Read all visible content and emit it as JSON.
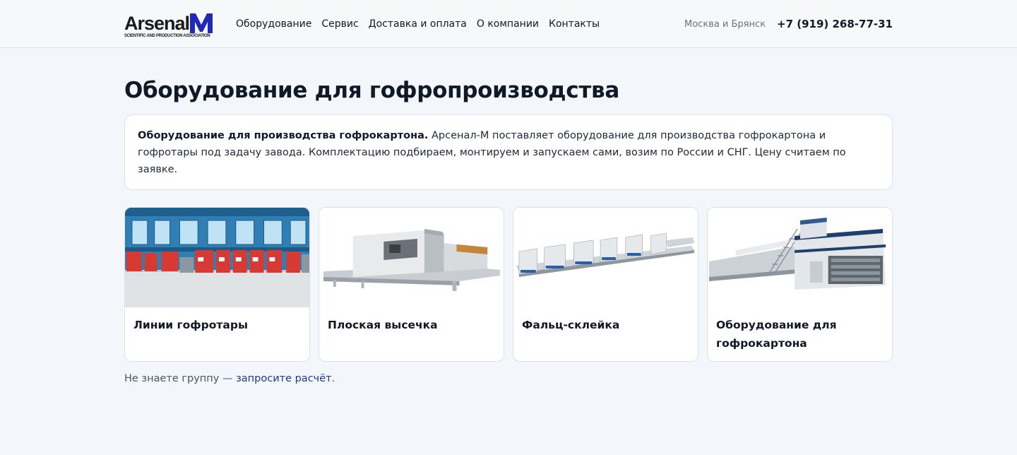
{
  "header": {
    "logo": {
      "word": "Arsenal",
      "letter": "M",
      "tagline": "SCIENTIFIC AND PRODUCTION ASSOCIATION"
    },
    "nav": [
      {
        "label": "Оборудование"
      },
      {
        "label": "Сервис"
      },
      {
        "label": "Доставка и оплата"
      },
      {
        "label": "О компании"
      },
      {
        "label": "Контакты"
      }
    ],
    "city": "Москва и Брянск",
    "phone": "+7 (919) 268-77-31"
  },
  "main": {
    "title": "Оборудование для гофропроизводства",
    "intro": {
      "lead": "Оборудование для производства гофрокартона.",
      "text": " Арсенал-М поставляет оборудование для производства гофрокартона и гофротары под задачу завода. Комплектацию подбираем, монтируем и запускаем сами, возим по России и СНГ. Цену считаем по заявке."
    },
    "cards": [
      {
        "title": "Линии гофротары"
      },
      {
        "title": "Плоская высечка"
      },
      {
        "title": "Фальц-склейка"
      },
      {
        "title": "Оборудование для гофрокартона"
      }
    ],
    "footnote": {
      "prefix": "Не знаете группу — ",
      "link": "запросите расчёт",
      "suffix": "."
    }
  },
  "colors": {
    "background": "#f3f6fb",
    "logo_accent": "#1f2bb8",
    "link": "#1e3a8a",
    "line_red": "#d63a32"
  }
}
